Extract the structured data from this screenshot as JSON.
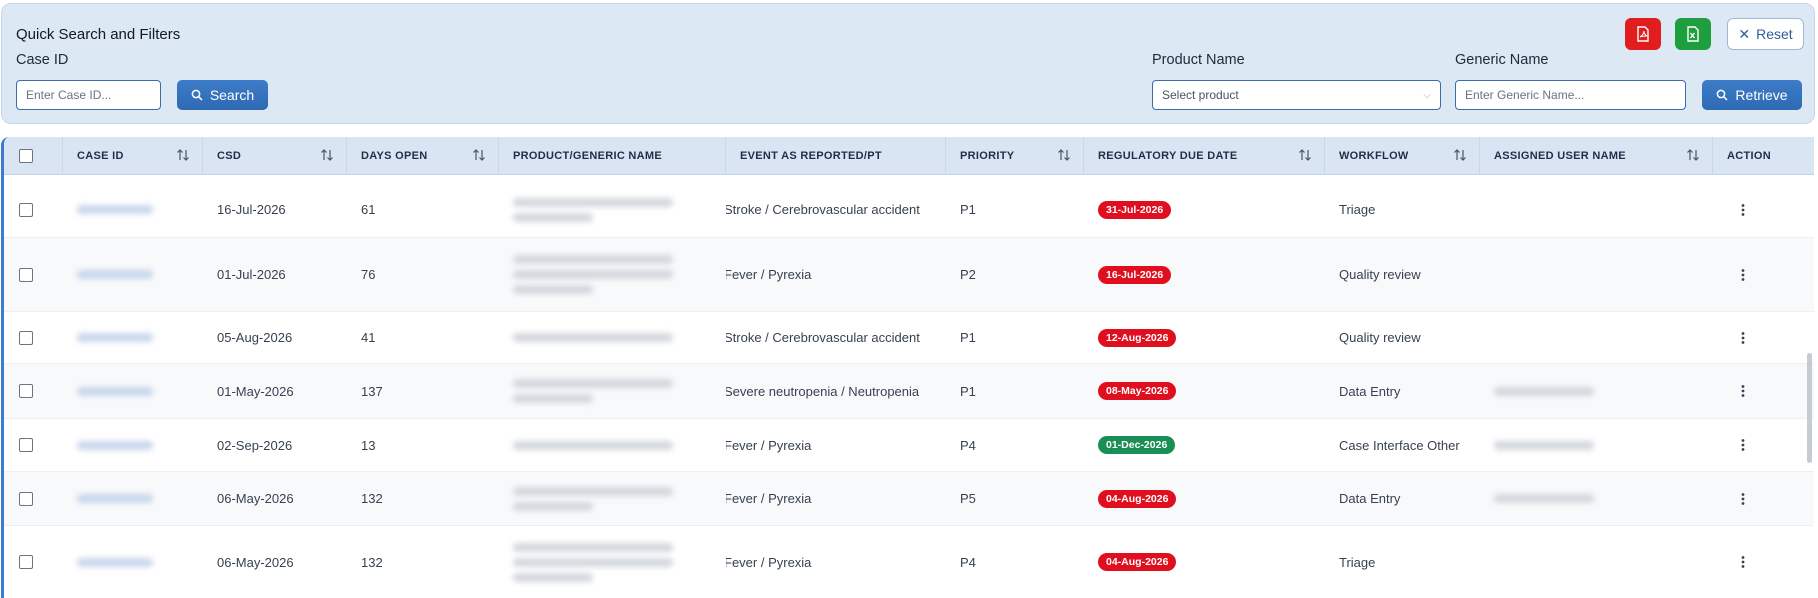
{
  "filters": {
    "title": "Quick Search and Filters",
    "case_id_label": "Case ID",
    "case_id_placeholder": "Enter Case ID...",
    "search_label": "Search",
    "product_name_label": "Product Name",
    "product_placeholder": "Select product",
    "generic_name_label": "Generic Name",
    "generic_placeholder": "Enter Generic Name...",
    "retrieve_label": "Retrieve",
    "reset_label": "Reset"
  },
  "table": {
    "headers": [
      "CASE ID",
      "CSD",
      "DAYS OPEN",
      "PRODUCT/GENERIC NAME",
      "EVENT AS REPORTED/PT",
      "PRIORITY",
      "REGULATORY DUE DATE",
      "WORKFLOW",
      "ASSIGNED USER NAME",
      "ACTION"
    ],
    "rows": [
      {
        "csd": "16-Jul-2026",
        "days_open": "61",
        "event": "Stroke / Cerebrovascular accident",
        "priority": "P1",
        "due_date": "31-Jul-2026",
        "due_status": "red",
        "workflow": "Triage"
      },
      {
        "csd": "01-Jul-2026",
        "days_open": "76",
        "event": "Fever / Pyrexia",
        "priority": "P2",
        "due_date": "16-Jul-2026",
        "due_status": "red",
        "workflow": "Quality review"
      },
      {
        "csd": "05-Aug-2026",
        "days_open": "41",
        "event": "Stroke / Cerebrovascular accident",
        "priority": "P1",
        "due_date": "12-Aug-2026",
        "due_status": "red",
        "workflow": "Quality review"
      },
      {
        "csd": "01-May-2026",
        "days_open": "137",
        "event": "Severe neutropenia / Neutropenia",
        "priority": "P1",
        "due_date": "08-May-2026",
        "due_status": "red",
        "workflow": "Data Entry"
      },
      {
        "csd": "02-Sep-2026",
        "days_open": "13",
        "event": "Fever / Pyrexia",
        "priority": "P4",
        "due_date": "01-Dec-2026",
        "due_status": "green",
        "workflow": "Case Interface Other"
      },
      {
        "csd": "06-May-2026",
        "days_open": "132",
        "event": "Fever / Pyrexia",
        "priority": "P5",
        "due_date": "04-Aug-2026",
        "due_status": "red",
        "workflow": "Data Entry"
      },
      {
        "csd": "06-May-2026",
        "days_open": "132",
        "event": "Fever / Pyrexia",
        "priority": "P4",
        "due_date": "04-Aug-2026",
        "due_status": "red",
        "workflow": "Triage"
      }
    ]
  },
  "icons": {
    "pdf_export": "pdf-file-icon",
    "excel_export": "excel-file-icon",
    "search": "search-icon",
    "reset": "close-icon",
    "sort": "sort-arrows-icon",
    "action": "kebab-menu-icon"
  },
  "colors": {
    "pdf_button": "#e11d1d",
    "excel_button": "#1e9e3e",
    "primary_button": "#2f6ab3",
    "badge_overdue": "#e00f1f",
    "badge_ok": "#1a8f55",
    "panel_bg": "#dde8f5"
  }
}
